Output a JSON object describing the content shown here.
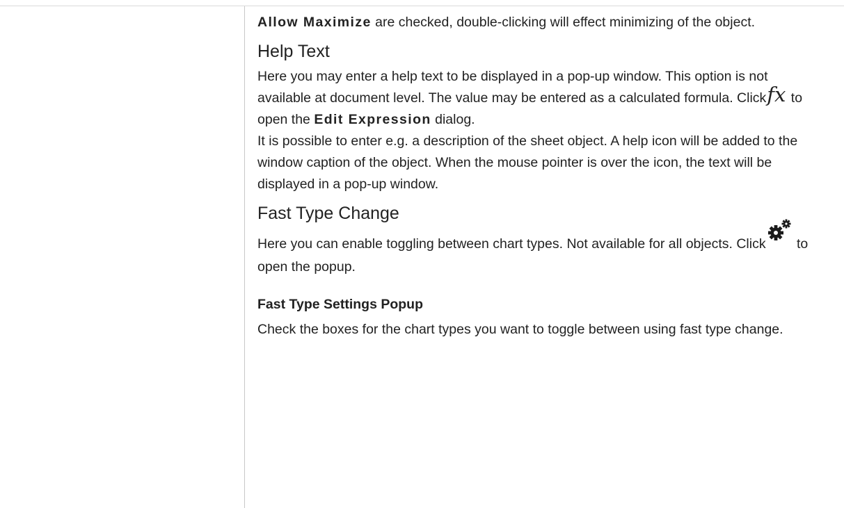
{
  "intro": {
    "bold_term": "Allow Maximize",
    "text": " are checked, double-clicking will effect minimizing of the object."
  },
  "help_text": {
    "heading": "Help Text",
    "para1_before_icon": "Here you may enter a help text to be displayed in a pop-up window. This option is not available at document level. The value may be entered as a calculated formula. Click",
    "icon_name": "fx-icon",
    "icon_glyph": "fx",
    "para1_mid": " to open the ",
    "para1_bold": "Edit Expression",
    "para1_end": " dialog.",
    "para2": "It is possible to enter e.g. a description of the sheet object. A help icon will be added to the window caption of the object. When the mouse pointer is over the icon, the text will be displayed in a pop-up window."
  },
  "fast_type_change": {
    "heading": "Fast Type Change",
    "para_before_icon": "Here you can enable toggling between chart types. Not available for all objects. Click",
    "icon_name": "gear-icon",
    "para_after_icon": " to open the popup."
  },
  "fast_type_settings": {
    "heading": "Fast Type Settings Popup",
    "para": "Check the boxes for the chart types you want to toggle between using fast type change."
  },
  "colors": {
    "text": "#222222",
    "divider": "#c8c8c8",
    "icon": "#1a1a1a"
  }
}
